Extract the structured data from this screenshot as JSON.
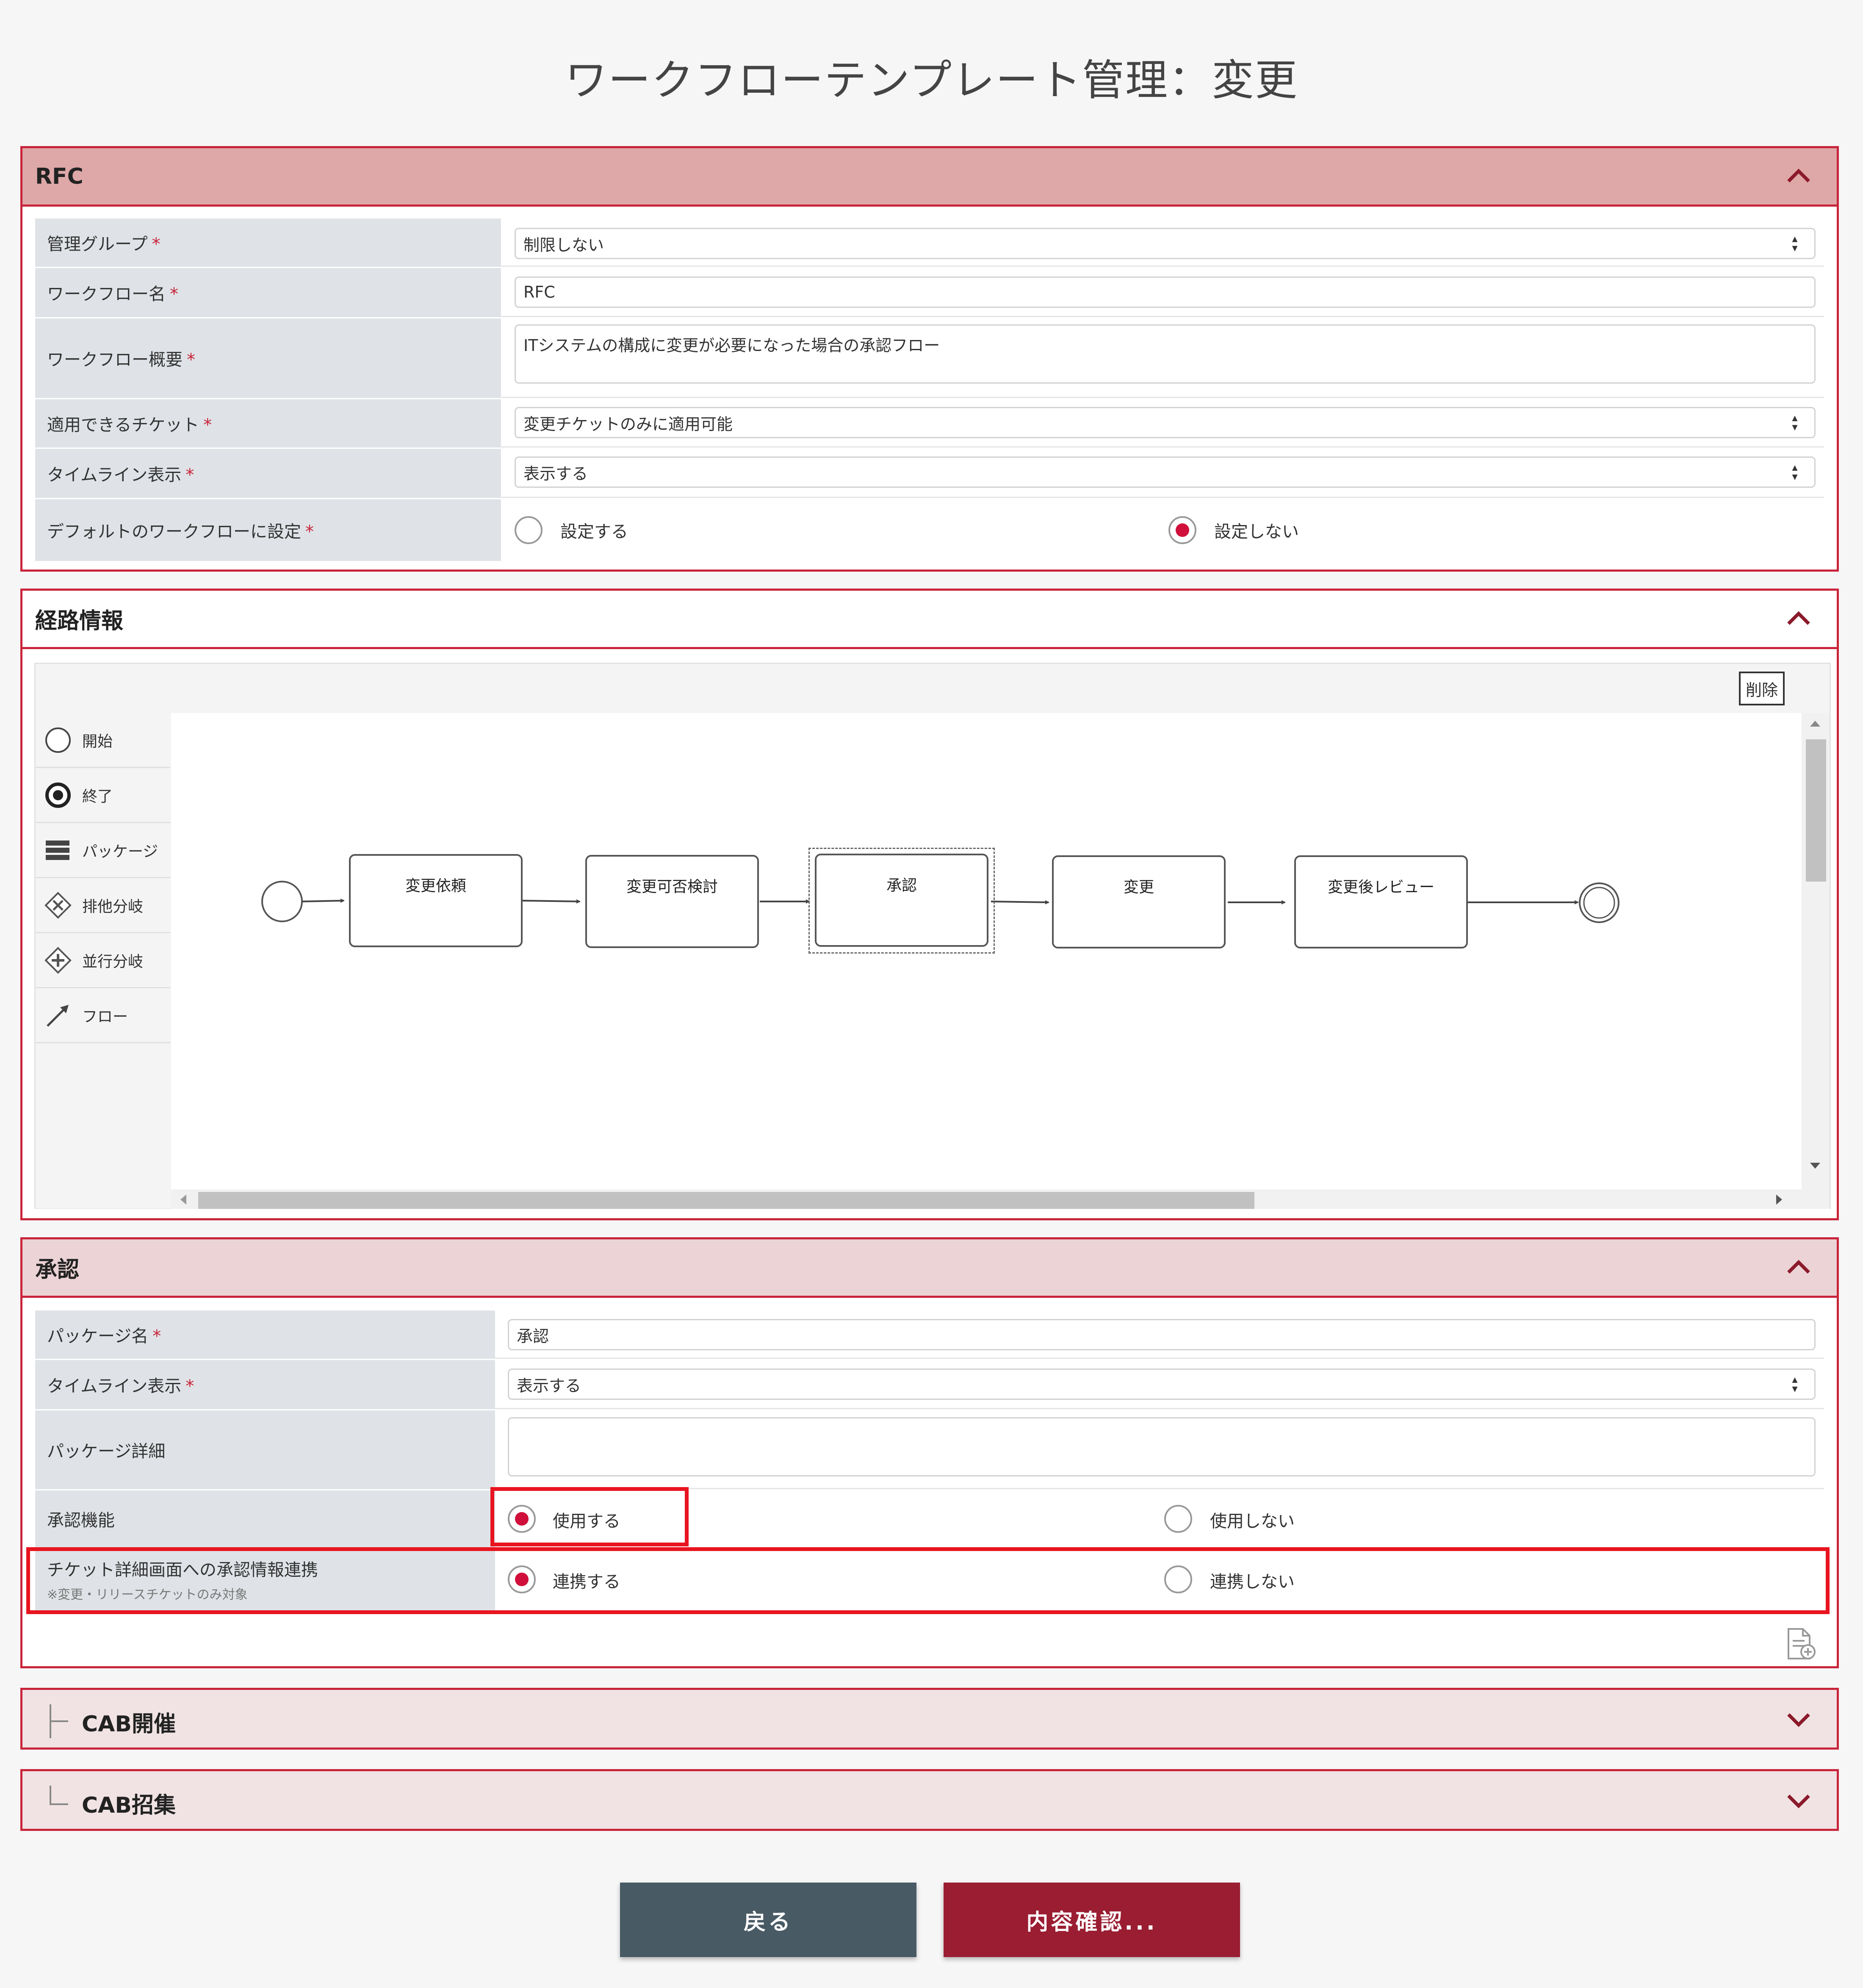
{
  "page_title": "ワークフローテンプレート管理：変更",
  "rfc_panel": {
    "title": "RFC",
    "fields": {
      "management_group": {
        "label": "管理グループ",
        "value": "制限しない"
      },
      "workflow_name": {
        "label": "ワークフロー名",
        "value": "RFC"
      },
      "workflow_summary": {
        "label": "ワークフロー概要",
        "value": "ITシステムの構成に変更が必要になった場合の承認フロー"
      },
      "applicable_ticket": {
        "label": "適用できるチケット",
        "value": "変更チケットのみに適用可能"
      },
      "timeline_display": {
        "label": "タイムライン表示",
        "value": "表示する"
      },
      "default_workflow": {
        "label": "デフォルトのワークフローに設定",
        "option_yes": "設定する",
        "option_no": "設定しない",
        "selected": "設定しない"
      }
    },
    "required_mark": "*"
  },
  "route_panel": {
    "title": "経路情報",
    "delete_label": "削除",
    "palette": [
      "開始",
      "終了",
      "パッケージ",
      "排他分岐",
      "並行分岐",
      "フロー"
    ],
    "nodes": [
      "変更依頼",
      "変更可否検討",
      "承認",
      "変更",
      "変更後レビュー"
    ]
  },
  "approval_panel": {
    "title": "承認",
    "fields": {
      "package_name": {
        "label": "パッケージ名",
        "value": "承認"
      },
      "timeline_display": {
        "label": "タイムライン表示",
        "value": "表示する"
      },
      "package_detail": {
        "label": "パッケージ詳細",
        "value": ""
      },
      "approval_function": {
        "label": "承認機能",
        "option_yes": "使用する",
        "option_no": "使用しない",
        "selected": "使用する"
      },
      "ticket_link": {
        "label": "チケット詳細画面への承認情報連携",
        "note": "※変更・リリースチケットのみ対象",
        "option_yes": "連携する",
        "option_no": "連携しない",
        "selected": "連携する"
      }
    }
  },
  "cab_hold": {
    "title": "CAB開催"
  },
  "cab_call": {
    "title": "CAB招集"
  },
  "buttons": {
    "back": "戻る",
    "confirm": "内容確認..."
  },
  "colors": {
    "accent": "#c8243a",
    "head_rfc": "#dea7a8",
    "head_approval": "#ecd3d5",
    "head_cab": "#f1e3e4",
    "back_btn": "#485a64",
    "confirm_btn": "#9a1d32",
    "highlight": "#e8141f"
  }
}
